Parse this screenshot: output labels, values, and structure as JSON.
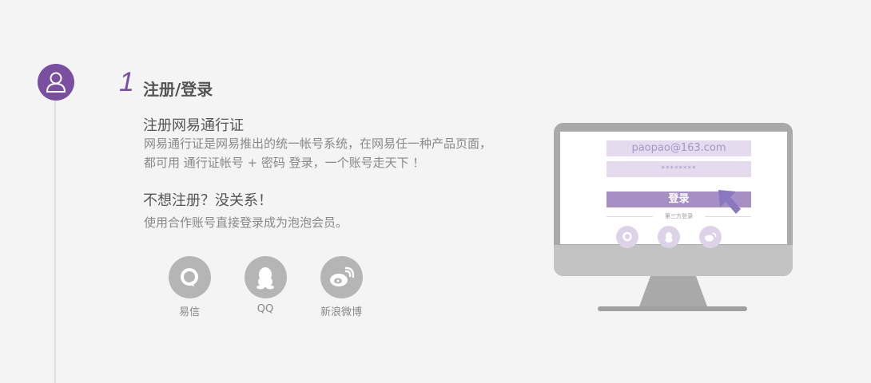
{
  "step": {
    "number": "1",
    "title": "注册/登录"
  },
  "section1": {
    "heading": "注册网易通行证",
    "line1": "网易通行证是网易推出的统一帐号系统，在网易任一种产品页面，",
    "line2": "都可用 通行证帐号 + 密码 登录，一个账号走天下 ！"
  },
  "section2": {
    "heading": "不想注册？没关系！",
    "line1": "使用合作账号直接登录成为泡泡会员。"
  },
  "social": [
    {
      "label": "易信",
      "icon": "yixin-icon"
    },
    {
      "label": "QQ",
      "icon": "qq-icon"
    },
    {
      "label": "新浪微博",
      "icon": "weibo-icon"
    }
  ],
  "monitor": {
    "email_value": "paopao@163.com",
    "password_value": "********",
    "login_label": "登录",
    "third_party_label": "第三方登录"
  },
  "colors": {
    "accent": "#7a4ea0",
    "background": "#f4f4f4",
    "icon_gray": "#b5b5b5"
  }
}
